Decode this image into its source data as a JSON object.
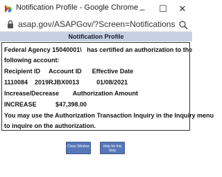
{
  "window": {
    "title": "Notification Profile - Google Chrome",
    "controls": {
      "minimize": "–",
      "maximize": "☐",
      "close": "✕"
    }
  },
  "addressbar": {
    "url": "asap.gov/ASAPGov/?Screen=NotificationsList&Button_Det..."
  },
  "page": {
    "header": "Notification Profile",
    "lines": [
      "Federal Agency 15040001\\   has certified an authorization to the",
      "following account:",
      "Recipient ID     Account ID      Effective Date",
      "1110084    2019RJBX0013          01/08/2021",
      "Increase/Decrease        Authorization Amount",
      "INCREASE           $47,398.00",
      "You may use the Authorization Transaction Inquiry in the Inquiry menu",
      "to inquire on the authorization."
    ],
    "buttons": {
      "close_window": "Close Window",
      "help": "Help for this Step"
    }
  },
  "colors": {
    "header_bg": "#c6d1e3",
    "button_bg": "#5777b8"
  }
}
